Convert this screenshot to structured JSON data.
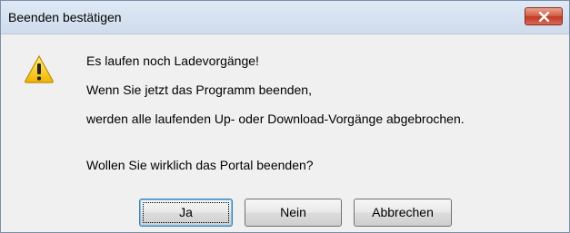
{
  "window": {
    "title": "Beenden bestätigen"
  },
  "icon": {
    "name": "warning-icon",
    "color": "#f5c400"
  },
  "message": {
    "line1": "Es laufen noch Ladevorgänge!",
    "line2": "Wenn Sie jetzt das Programm beenden,",
    "line3": "werden alle laufenden Up- oder Download-Vorgänge abgebrochen.",
    "question": "Wollen Sie wirklich das Portal beenden?"
  },
  "buttons": {
    "yes": "Ja",
    "no": "Nein",
    "cancel": "Abbrechen"
  }
}
